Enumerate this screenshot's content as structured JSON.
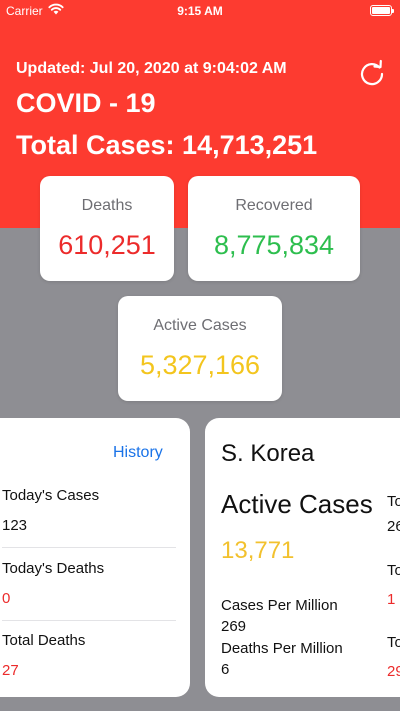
{
  "status_bar": {
    "carrier": "Carrier",
    "time": "9:15 AM"
  },
  "header": {
    "updated": "Updated: Jul 20, 2020 at 9:04:02 AM",
    "title": "COVID - 19",
    "total_cases": "Total Cases: 14,713,251",
    "refresh_icon": "refresh-icon"
  },
  "stats": {
    "deaths": {
      "label": "Deaths",
      "value": "610,251",
      "color": "#ec2b2b"
    },
    "recovered": {
      "label": "Recovered",
      "value": "8,775,834",
      "color": "#2dbe4e"
    },
    "active": {
      "label": "Active Cases",
      "value": "5,327,166",
      "color": "#f3c51e"
    }
  },
  "global_panel": {
    "history": "History",
    "rows": [
      {
        "label": "Today's Cases",
        "value": "123",
        "value_color": "#111111"
      },
      {
        "label": "Today's Deaths",
        "value": "0",
        "value_color": "#ec2b2b"
      },
      {
        "label": "Total Deaths",
        "value": "27",
        "value_color": "#ec2b2b"
      }
    ]
  },
  "country_panel": {
    "country": "S. Korea",
    "active_label": "Active Cases",
    "active_value": "13,771",
    "cases_per_million_label": "Cases Per Million",
    "cases_per_million_value": "269",
    "deaths_per_million_label": "Deaths Per Million",
    "deaths_per_million_value": "6"
  },
  "next_panel_peek": {
    "t1": "To",
    "v1": "26",
    "t2": "To",
    "v2": "1",
    "t3": "To",
    "v3": "29"
  },
  "colors": {
    "header_red": "#fd3b30",
    "background_gray": "#8e8e93",
    "link_blue": "#1a73e8"
  }
}
